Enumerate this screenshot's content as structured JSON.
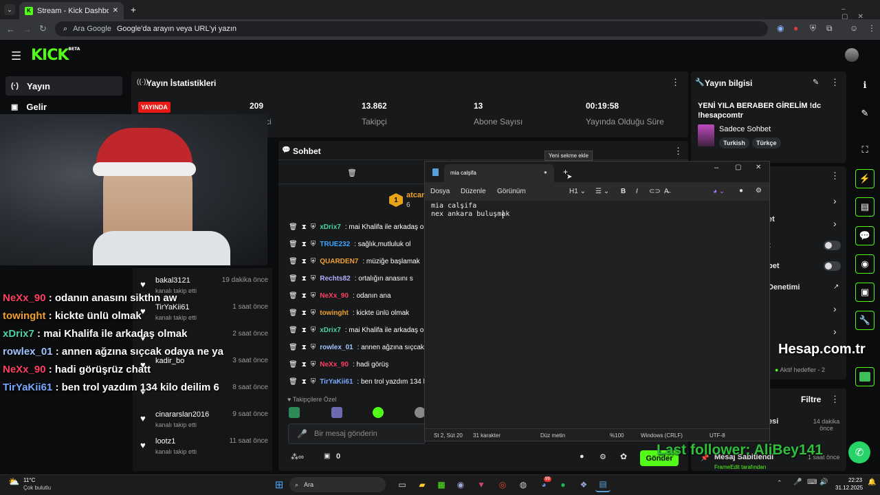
{
  "browser": {
    "tab_title": "Stream - Kick Dashboard",
    "new_tab": "+",
    "omnibox_search_label": "Ara Google",
    "omnibox_placeholder": "Google'da arayın veya URL'yi yazın"
  },
  "kick": {
    "logo": "KICK",
    "logo_badge": "BETA",
    "sidebar": [
      {
        "label": "Yayın",
        "icon": "broadcast-icon"
      },
      {
        "label": "Gelir",
        "icon": "money-icon"
      }
    ]
  },
  "stats_panel": {
    "title": "Yayın İstatistikleri",
    "live_badge": "YAYINDA",
    "stats": [
      {
        "value": "209",
        "label": "ci"
      },
      {
        "value": "13.862",
        "label": "Takipçi"
      },
      {
        "value": "13",
        "label": "Abone Sayısı"
      },
      {
        "value": "00:19:58",
        "label": "Yayında Olduğu Süre"
      }
    ]
  },
  "info_panel": {
    "title": "Yayın bilgisi",
    "stream_title": "YENİ YILA BERABER GİRELİM !dc !hesapcomtr",
    "category": "Sadece Sohbet",
    "tags": [
      "Turkish",
      "Türkçe"
    ]
  },
  "mid_panel": {
    "rows": [
      "et",
      "t",
      "bet",
      "Denetimi"
    ],
    "toggles": [
      false,
      false
    ],
    "goals": "Aktif hedefler - 2"
  },
  "activity_panel": {
    "title": "Filtre",
    "item_name": "esi",
    "item_time": "14 dakika önce",
    "item2_time": "1 saat önce",
    "item2_name": "Mesaj Sabitlendi",
    "item2_sub": "FrameEdit tarafından"
  },
  "chat_panel": {
    "title": "Sohbet",
    "pinned_user": "atcar",
    "pinned_count": "6",
    "pinned_rank": "1",
    "followers_only": "Takipçilere Özel",
    "input_placeholder": "Bir mesaj gönderin",
    "send_label": "Gönder",
    "counter": "0",
    "messages": [
      {
        "user": "xDrix7",
        "color": "#4fd1a5",
        "text": "mai Khalifa ile arkadaş o"
      },
      {
        "user": "TRUE232",
        "color": "#3ea6ff",
        "text": "sağlık,mutluluk ol"
      },
      {
        "user": "QUARDEN7",
        "color": "#f0a030",
        "text": "müziğe başlamak"
      },
      {
        "user": "Rechts82",
        "color": "#b0b0ff",
        "text": "ortalığın anasını s"
      },
      {
        "user": "NeXx_90",
        "color": "#ff4060",
        "text": "odanın ana"
      },
      {
        "user": "towinght",
        "color": "#f0a030",
        "text": "kickte ünlü olmak"
      },
      {
        "user": "xDrix7",
        "color": "#4fd1a5",
        "text": "mai Khalifa ile arkadaş o"
      },
      {
        "user": "rowlex_01",
        "color": "#a0c4ff",
        "text": "annen ağzına sıçcak"
      },
      {
        "user": "NeXx_90",
        "color": "#ff4060",
        "text": "hadi görüş"
      },
      {
        "user": "TirYaKii61",
        "color": "#7aa8ff",
        "text": "ben trol yazdım 134 l"
      }
    ]
  },
  "followers": [
    {
      "name": "bakal3121",
      "sub": "kanalı takip etti",
      "time": "19 dakika önce"
    },
    {
      "name": "TirYaKii61",
      "sub": "kanalı takip etti",
      "time": "1 saat önce"
    },
    {
      "name": "",
      "sub": "",
      "time": "2 saat önce"
    },
    {
      "name": "kadir_bo",
      "sub": "",
      "time": "3 saat önce"
    },
    {
      "name": "",
      "sub": "",
      "time": "8 saat önce"
    },
    {
      "name": "cinararslan2016",
      "sub": "kanalı takip etti",
      "time": "9 saat önce"
    },
    {
      "name": "lootz1",
      "sub": "kanalı takip etti",
      "time": "11 saat önce"
    }
  ],
  "overlay_chat": [
    {
      "user": "NeXx_90",
      "text": " : odanın anasını sikthn aw",
      "color": "#ff4060"
    },
    {
      "user": "towinght",
      "text": " : kickte ünlü olmak",
      "color": "#f0a030"
    },
    {
      "user": "xDrix7",
      "text": " : mai Khalifa ile arkadaş olmak",
      "color": "#4fd1a5"
    },
    {
      "user": "rowlex_01",
      "text": " : annen ağzına sıçcak odaya ne ya",
      "color": "#a0c4ff"
    },
    {
      "user": "NeXx_90",
      "text": " : hadi görüşrüz chatt",
      "color": "#ff4060"
    },
    {
      "user": "TirYaKii61",
      "text": " : ben trol yazdım 134 kilo deilim 6",
      "color": "#7aa8ff"
    }
  ],
  "notepad": {
    "tooltip": "Yeni sekme ekle",
    "tab_title": "mia calşifa",
    "menu": [
      "Dosya",
      "Düzenle",
      "Görünüm"
    ],
    "heading": "H1",
    "lines": [
      "mia calşifa",
      "nex ankara buluşmak"
    ],
    "status": {
      "pos": "St 2, Süt 20",
      "chars": "31 karakter",
      "format": "Düz metin",
      "zoom": "%100",
      "eol": "Windows (CRLF)",
      "enc": "UTF-8"
    }
  },
  "watermark": "Hesap.com.tr",
  "last_follower": "Last follower: AliBey141",
  "taskbar": {
    "temp": "11°C",
    "weather": "Çok bulutlu",
    "search": "Ara",
    "time": "22:23",
    "date": "31.12.2025",
    "badge": "99"
  },
  "colors": {
    "kick_green": "#53fc18",
    "live_red": "#e91916",
    "bg": "#0b0c0d",
    "panel": "#17191b"
  }
}
